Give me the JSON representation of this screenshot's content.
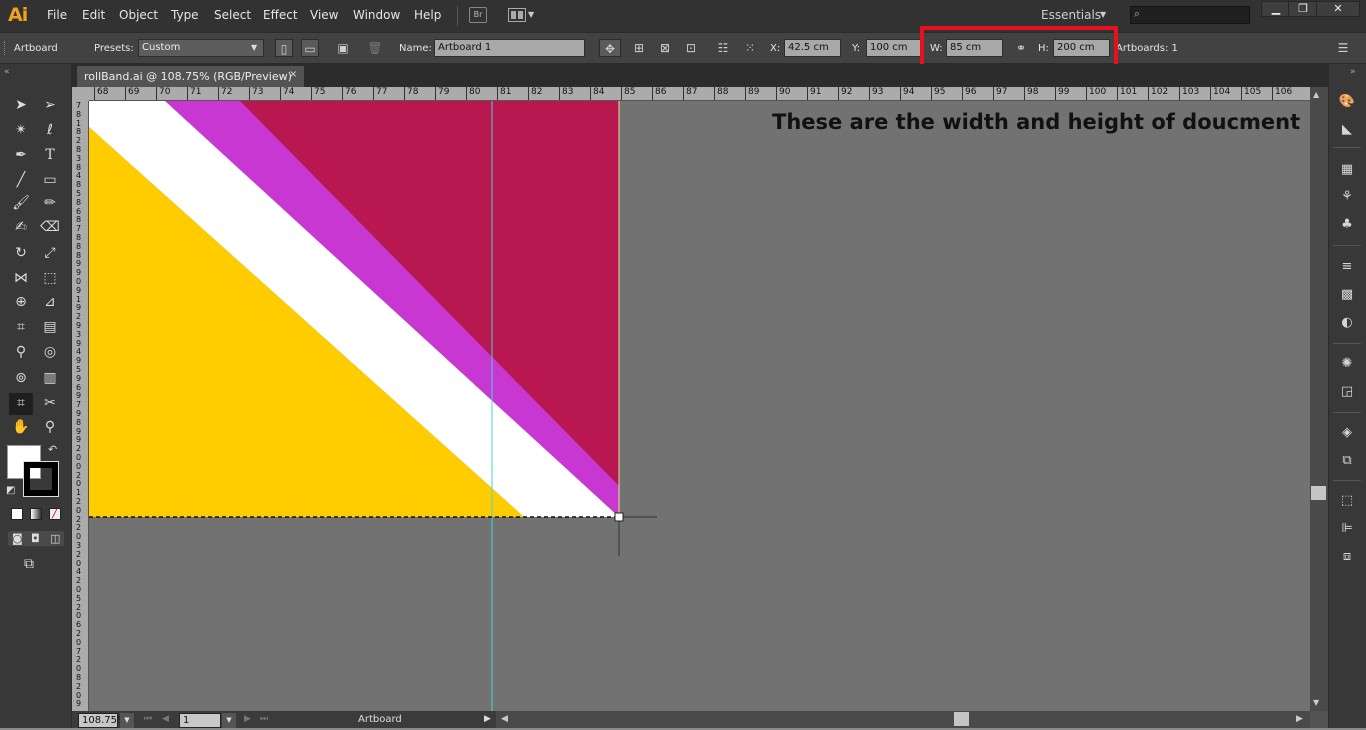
{
  "app": {
    "logo": "Ai"
  },
  "menus": [
    "File",
    "Edit",
    "Object",
    "Type",
    "Select",
    "Effect",
    "View",
    "Window",
    "Help"
  ],
  "bridge_button": "Br",
  "workspace": "Essentials",
  "window_controls": {
    "minimize": "▁",
    "restore": "❐",
    "close": "✕"
  },
  "control_bar": {
    "tool_name": "Artboard",
    "presets_label": "Presets:",
    "presets_value": "Custom",
    "name_label": "Name:",
    "name_value": "Artboard 1",
    "x_label": "X:",
    "x_value": "42.5 cm",
    "y_label": "Y:",
    "y_value": "100 cm",
    "w_label": "W:",
    "w_value": "85 cm",
    "h_label": "H:",
    "h_value": "200 cm",
    "artboards_label": "Artboards: 1"
  },
  "document": {
    "tab_title": "rollBand.ai @ 108.75% (RGB/Preview)",
    "close": "×"
  },
  "ruler": {
    "horizontal": [
      "68",
      "69",
      "70",
      "71",
      "72",
      "73",
      "74",
      "75",
      "76",
      "77",
      "78",
      "79",
      "80",
      "81",
      "82",
      "83",
      "84",
      "85",
      "86",
      "87",
      "88",
      "89",
      "90",
      "91",
      "92",
      "93",
      "94",
      "95",
      "96",
      "97",
      "98",
      "99",
      "100",
      "101",
      "102",
      "103",
      "104",
      "105",
      "106"
    ],
    "vertical": [
      "7",
      "8",
      "1",
      "8",
      "2",
      "8",
      "3",
      "8",
      "4",
      "8",
      "5",
      "8",
      "6",
      "8",
      "7",
      "8",
      "8",
      "8",
      "9",
      "9",
      "0",
      "9",
      "1",
      "9",
      "2",
      "9",
      "3",
      "9",
      "4",
      "9",
      "5",
      "9",
      "6",
      "9",
      "7",
      "9",
      "8",
      "9",
      "9",
      "2",
      "0",
      "0",
      "2",
      "0",
      "1",
      "2",
      "0",
      "2",
      "2",
      "0",
      "3",
      "2",
      "0",
      "4",
      "2",
      "0",
      "5",
      "2",
      "0",
      "6",
      "2",
      "0",
      "7",
      "2",
      "0",
      "8",
      "2",
      "0",
      "9"
    ]
  },
  "annotation": "These are the width and height of doucment",
  "artwork_colors": {
    "background": "#727272",
    "yellow": "#FFCC00",
    "white": "#FFFFFF",
    "magenta": "#C837D2",
    "crimson": "#B8174F"
  },
  "highlight_color": "#E8101A",
  "status_bar": {
    "zoom": "108.75%",
    "artboard_number": "1",
    "tool": "Artboard"
  }
}
